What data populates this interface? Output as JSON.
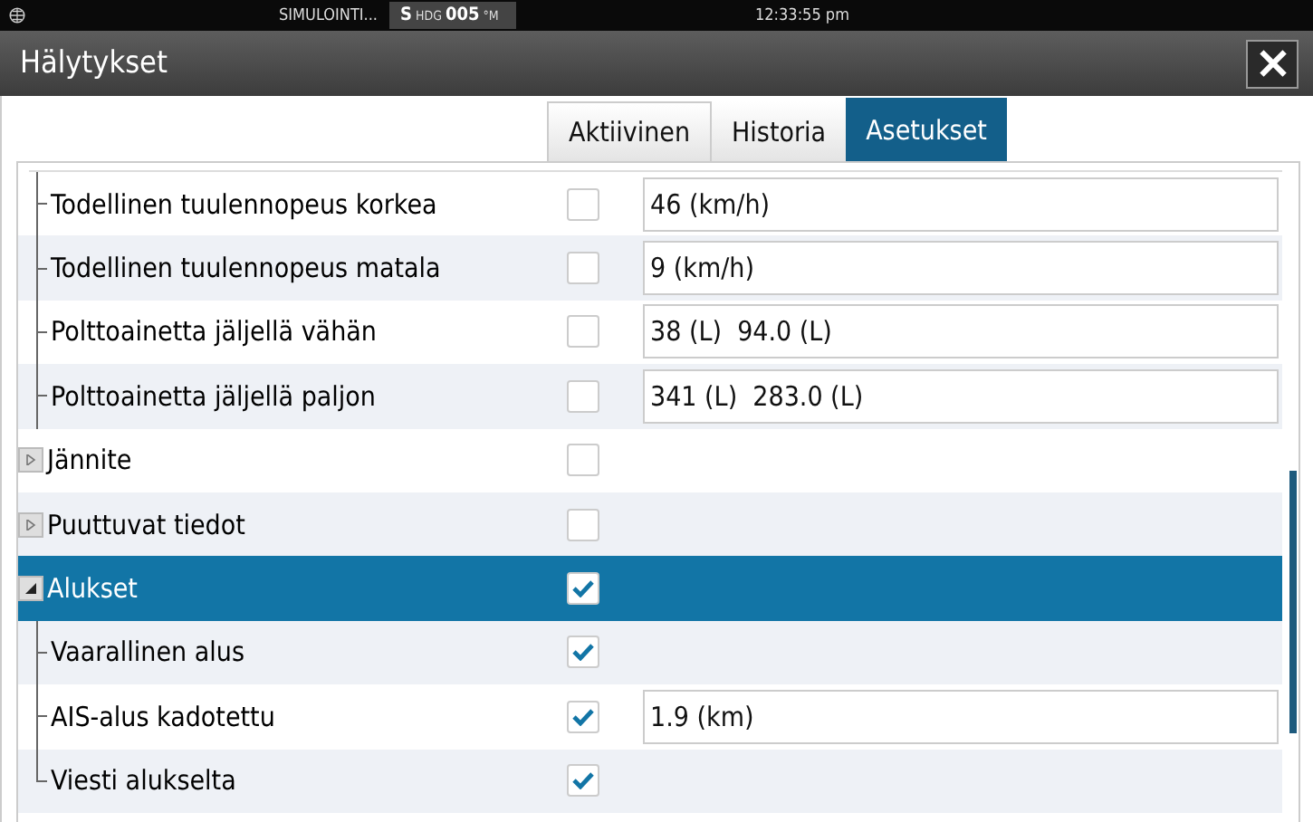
{
  "status_bar": {
    "mode": "SIMULOINTI...",
    "heading": {
      "prefix": "S",
      "label": "HDG",
      "value": "005",
      "unit": "°M"
    },
    "time": "12:33:55 pm"
  },
  "window": {
    "title": "Hälytykset"
  },
  "tabs": [
    {
      "label": "Aktiivinen",
      "selected": false
    },
    {
      "label": "Historia",
      "selected": false
    },
    {
      "label": "Asetukset",
      "selected": true
    }
  ],
  "tree": {
    "continued_children": [
      {
        "label": "Todellinen tuulennopeus korkea",
        "checked": false,
        "selected": false,
        "value": "46 (km/h)"
      },
      {
        "label": "Todellinen tuulennopeus matala",
        "checked": false,
        "selected": false,
        "value": "9 (km/h)"
      },
      {
        "label": "Polttoainetta jäljellä vähän",
        "checked": false,
        "selected": false,
        "value": "38 (L)  94.0 (L)"
      },
      {
        "label": "Polttoainetta jäljellä paljon",
        "checked": false,
        "selected": false,
        "value": "341 (L)  283.0 (L)"
      }
    ],
    "items": [
      {
        "label": "Jännite",
        "checked": false,
        "selected": false,
        "expanded": false
      },
      {
        "label": "Puuttuvat tiedot",
        "checked": false,
        "selected": false,
        "expanded": false
      },
      {
        "label": "Alukset",
        "checked": true,
        "selected": true,
        "expanded": true,
        "children": [
          {
            "label": "Vaarallinen alus",
            "checked": true,
            "selected": false
          },
          {
            "label": "AIS-alus kadotettu",
            "checked": true,
            "selected": false,
            "value": "1.9 (km)"
          },
          {
            "label": "Viesti alukselta",
            "checked": true,
            "selected": false
          }
        ]
      }
    ]
  }
}
